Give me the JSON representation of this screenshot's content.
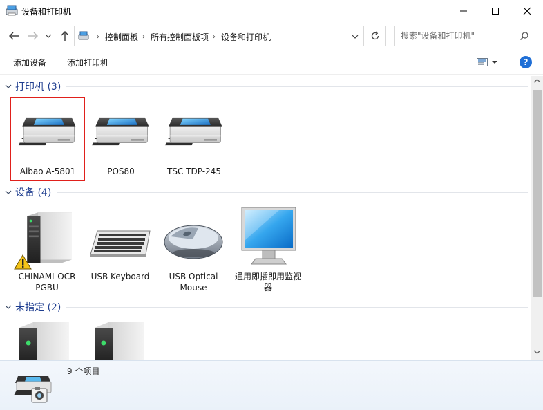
{
  "window": {
    "title": "设备和打印机"
  },
  "breadcrumb": [
    "控制面板",
    "所有控制面板项",
    "设备和打印机"
  ],
  "search": {
    "placeholder": "搜索\"设备和打印机\""
  },
  "commands": {
    "add_device": "添加设备",
    "add_printer": "添加打印机",
    "help": "?"
  },
  "groups": {
    "printers": {
      "title": "打印机 (3)",
      "items": [
        {
          "label": "Aibao A-5801",
          "icon": "printer-icon",
          "selected": true
        },
        {
          "label": "POS80",
          "icon": "printer-icon"
        },
        {
          "label": "TSC TDP-245",
          "icon": "printer-icon"
        }
      ]
    },
    "devices": {
      "title": "设备 (4)",
      "items": [
        {
          "label": "CHINAMI-OCR PGBU",
          "icon": "computer-tower-icon",
          "warning": true
        },
        {
          "label": "USB Keyboard",
          "icon": "keyboard-icon"
        },
        {
          "label": "USB Optical Mouse",
          "icon": "mouse-icon"
        },
        {
          "label": "通用即插即用监视器",
          "icon": "monitor-icon"
        }
      ]
    },
    "unspecified": {
      "title": "未指定 (2)",
      "items": [
        {
          "label": "",
          "icon": "device-tower-icon"
        },
        {
          "label": "",
          "icon": "device-tower-icon"
        }
      ]
    }
  },
  "details": {
    "count": "9 个项目"
  },
  "colors": {
    "accent": "#1e3d8f",
    "selection": "#e0201b",
    "help": "#1f6fd6"
  }
}
